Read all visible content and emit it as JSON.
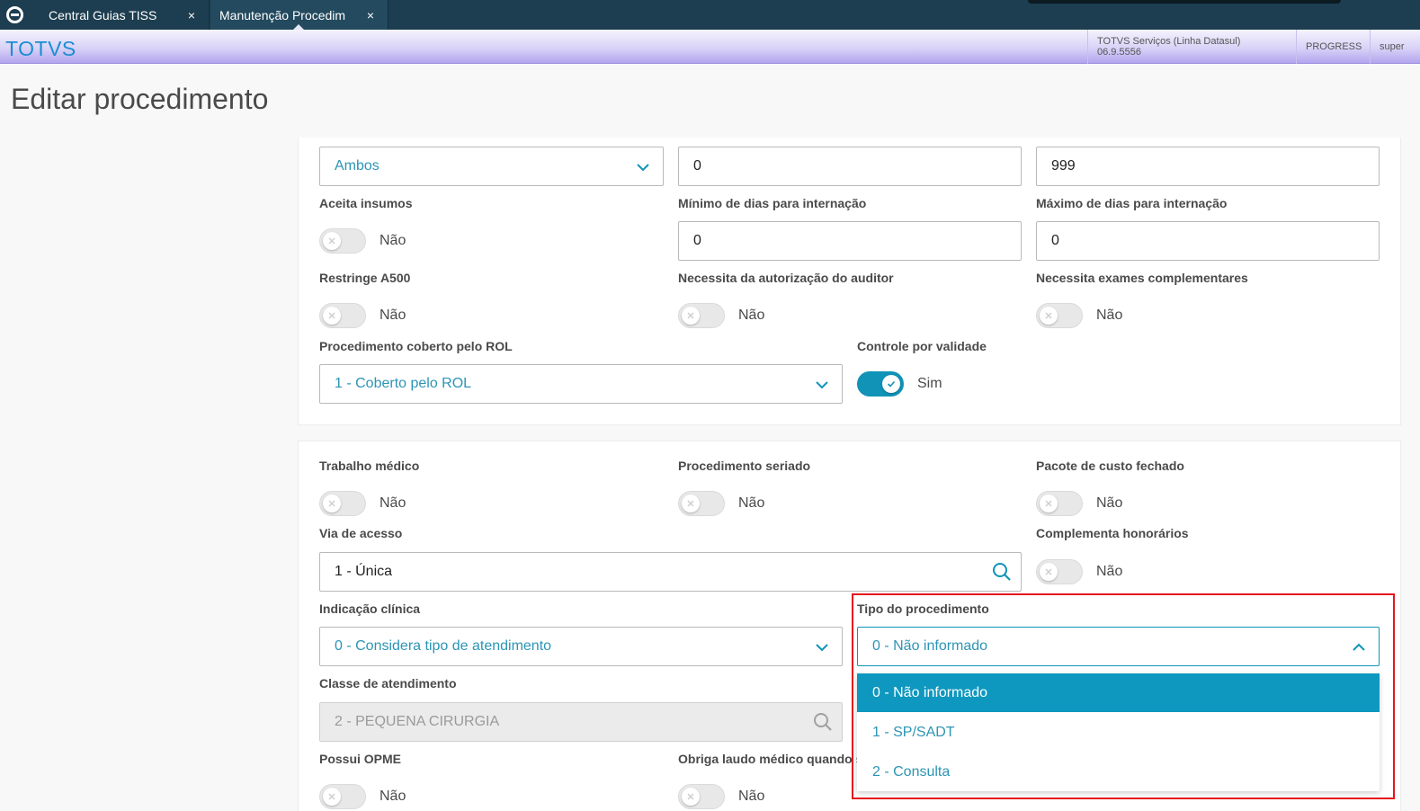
{
  "tabs": [
    {
      "label": "Central Guias TISS",
      "close": "×"
    },
    {
      "label": "Manutenção Procedim",
      "close": "×"
    }
  ],
  "header": {
    "brand": "TOTVS",
    "product": "TOTVS Serviços (Linha Datasul) 06.9.5556",
    "db": "PROGRESS",
    "user": "super"
  },
  "page_title": "Editar procedimento",
  "section1": {
    "top_select": {
      "value": "Ambos"
    },
    "min_days_top": {
      "value": "0"
    },
    "max_days_top": {
      "value": "999"
    },
    "aceita_insumos": {
      "label": "Aceita insumos",
      "state": "Não"
    },
    "min_dias_internacao": {
      "label": "Mínimo de dias para internação",
      "value": "0"
    },
    "max_dias_internacao": {
      "label": "Máximo de dias para internação",
      "value": "0"
    },
    "restringe_a500": {
      "label": "Restringe A500",
      "state": "Não"
    },
    "autorizacao_auditor": {
      "label": "Necessita da autorização do auditor",
      "state": "Não"
    },
    "exames_complementares": {
      "label": "Necessita exames complementares",
      "state": "Não"
    },
    "coberto_rol": {
      "label": "Procedimento coberto pelo ROL",
      "value": "1 - Coberto pelo ROL"
    },
    "controle_validade": {
      "label": "Controle por validade",
      "state": "Sim"
    }
  },
  "section2": {
    "trabalho_medico": {
      "label": "Trabalho médico",
      "state": "Não"
    },
    "procedimento_seriado": {
      "label": "Procedimento seriado",
      "state": "Não"
    },
    "pacote_custo": {
      "label": "Pacote de custo fechado",
      "state": "Não"
    },
    "via_acesso": {
      "label": "Via de acesso",
      "value": "1 - Única"
    },
    "complementa_honorarios": {
      "label": "Complementa honorários",
      "state": "Não"
    },
    "indicacao_clinica": {
      "label": "Indicação clínica",
      "value": "0 - Considera tipo de atendimento"
    },
    "tipo_procedimento": {
      "label": "Tipo do procedimento",
      "value": "0 - Não informado",
      "options": [
        "0 - Não informado",
        "1 - SP/SADT",
        "2 - Consulta"
      ]
    },
    "classe_atendimento": {
      "label": "Classe de atendimento",
      "value": "2 - PEQUENA CIRURGIA"
    },
    "possui_opme": {
      "label": "Possui OPME",
      "state": "Não"
    },
    "obriga_laudo": {
      "label": "Obriga laudo médico quando so",
      "state": "Não"
    }
  },
  "colors": {
    "accent": "#0e98bf",
    "highlight": "#e5141c",
    "topbar": "#1d3e50"
  }
}
